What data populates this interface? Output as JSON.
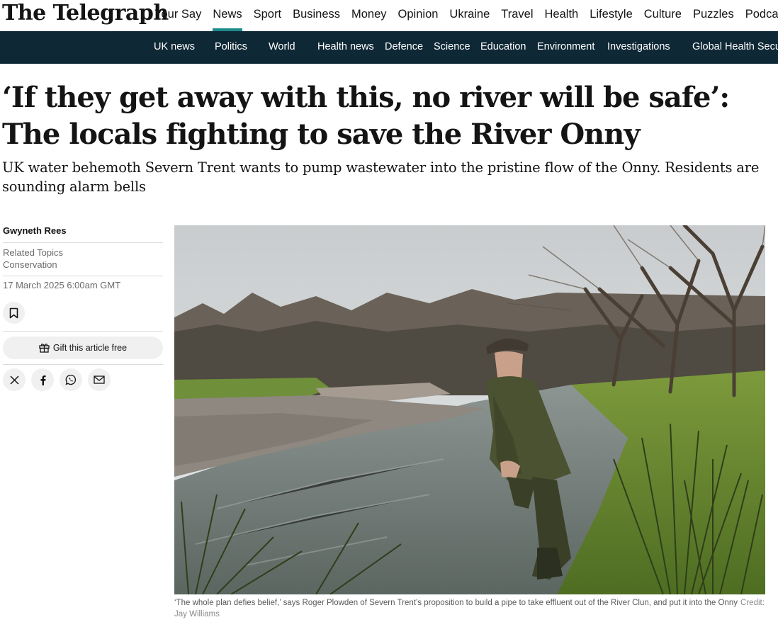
{
  "site": {
    "logo": "The Telegraph",
    "main_nav": [
      "Your Say",
      "News",
      "Sport",
      "Business",
      "Money",
      "Opinion",
      "Ukraine",
      "Travel",
      "Health",
      "Lifestyle",
      "Culture",
      "Puzzles",
      "Podcas"
    ],
    "active_nav": "News",
    "sub_nav": [
      "UK news",
      "Politics",
      "World",
      "Health news",
      "Defence",
      "Science",
      "Education",
      "Environment",
      "Investigations",
      "Global Health Secu"
    ],
    "colors": {
      "subnav_bg": "#0f2836",
      "active_underline": "#1d8a8a"
    }
  },
  "article": {
    "headline": "‘If they get away with this, no river will be safe’: The locals fighting to save the River Onny",
    "standfirst": "UK water behemoth Severn Trent wants to pump wastewater into the pristine flow of the Onny. Residents are sounding alarm bells",
    "author": "Gwyneth Rees",
    "related_topics_label": "Related Topics",
    "related_topic": "Conservation",
    "date": "17 March 2025 6:00am GMT",
    "gift_label": "Gift this article free",
    "share_icons": [
      "x-icon",
      "facebook-icon",
      "whatsapp-icon",
      "email-icon"
    ],
    "caption": "‘The whole plan defies belief,’ says Roger Plowden of Severn Trent’s proposition to build a pipe to take effluent out of the River Clun, and put it into the Onny",
    "credit": "Credit: Jay Williams"
  }
}
